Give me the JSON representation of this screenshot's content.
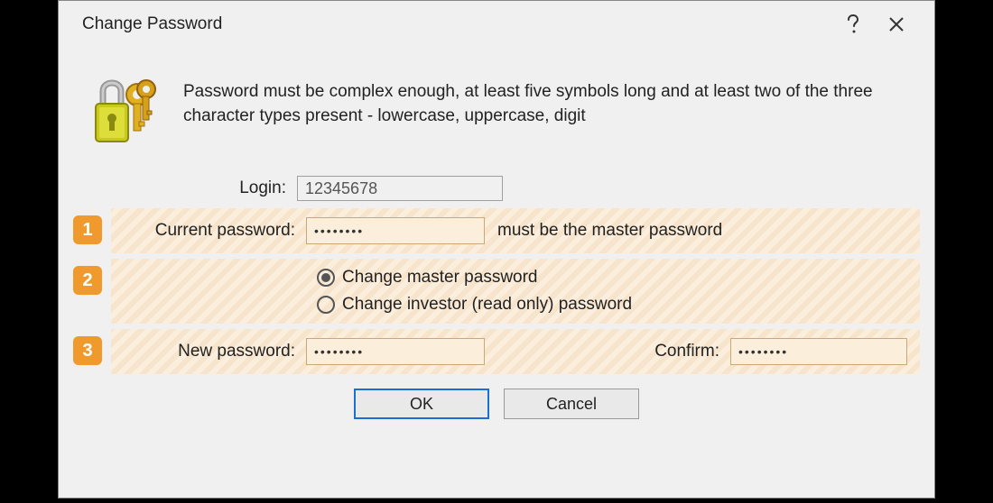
{
  "window": {
    "title": "Change Password"
  },
  "help": "Password must be complex enough, at least five symbols long and at least two of the three character types present - lowercase, uppercase, digit",
  "login": {
    "label": "Login:",
    "value": "12345678"
  },
  "step1": {
    "badge": "1",
    "label": "Current password:",
    "value": "••••••••",
    "hint": "must be the master password"
  },
  "step2": {
    "badge": "2",
    "opt_master": "Change master password",
    "opt_investor": "Change investor (read only) password"
  },
  "step3": {
    "badge": "3",
    "label": "New password:",
    "value": "••••••••",
    "confirm_label": "Confirm:",
    "confirm_value": "••••••••"
  },
  "buttons": {
    "ok": "OK",
    "cancel": "Cancel"
  }
}
